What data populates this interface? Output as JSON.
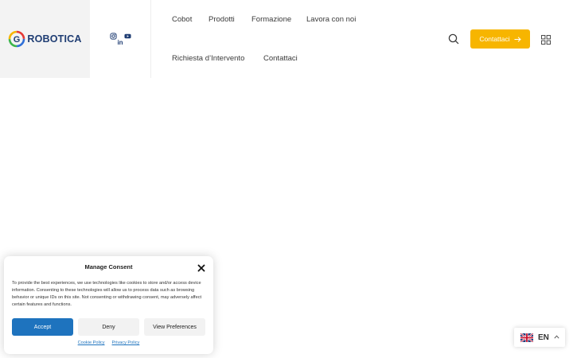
{
  "brand": {
    "name": "ROBOTICA",
    "mark_letter": "G",
    "colors": {
      "primary": "#1f3d73",
      "accent": "#f7b500",
      "green": "#3bb54a",
      "red": "#e53935",
      "blue": "#2e6fd8"
    }
  },
  "social": [
    {
      "name": "instagram",
      "icon": "instagram-icon"
    },
    {
      "name": "youtube",
      "icon": "youtube-icon"
    },
    {
      "name": "linkedin",
      "icon": "linkedin-icon",
      "glyph": "in"
    }
  ],
  "nav": {
    "items": [
      {
        "label": "Cobot"
      },
      {
        "label": "Prodotti"
      },
      {
        "label": "Formazione"
      },
      {
        "label": "Lavora con noi"
      },
      {
        "label": "Richiesta d’Intervento"
      },
      {
        "label": "Contattaci"
      }
    ]
  },
  "header_actions": {
    "search_icon": "search-icon",
    "cta_label": "Contattaci",
    "cta_icon": "arrow-right-icon",
    "grid_icon": "grid-menu-icon",
    "accent_color": "#f7b500"
  },
  "consent": {
    "title": "Manage Consent",
    "body": "To provide the best experiences, we use technologies like cookies to store and/or access device information. Consenting to these technologies will allow us to process data such as browsing behavior or unique IDs on this site. Not consenting or withdrawing consent, may adversely affect certain features and functions.",
    "accept_label": "Accept",
    "deny_label": "Deny",
    "preferences_label": "View Preferences",
    "links": [
      "Cookie Policy",
      "Privacy Policy"
    ],
    "accept_color": "#1e73be"
  },
  "language": {
    "code": "EN",
    "flag_icon": "uk-flag-icon"
  }
}
